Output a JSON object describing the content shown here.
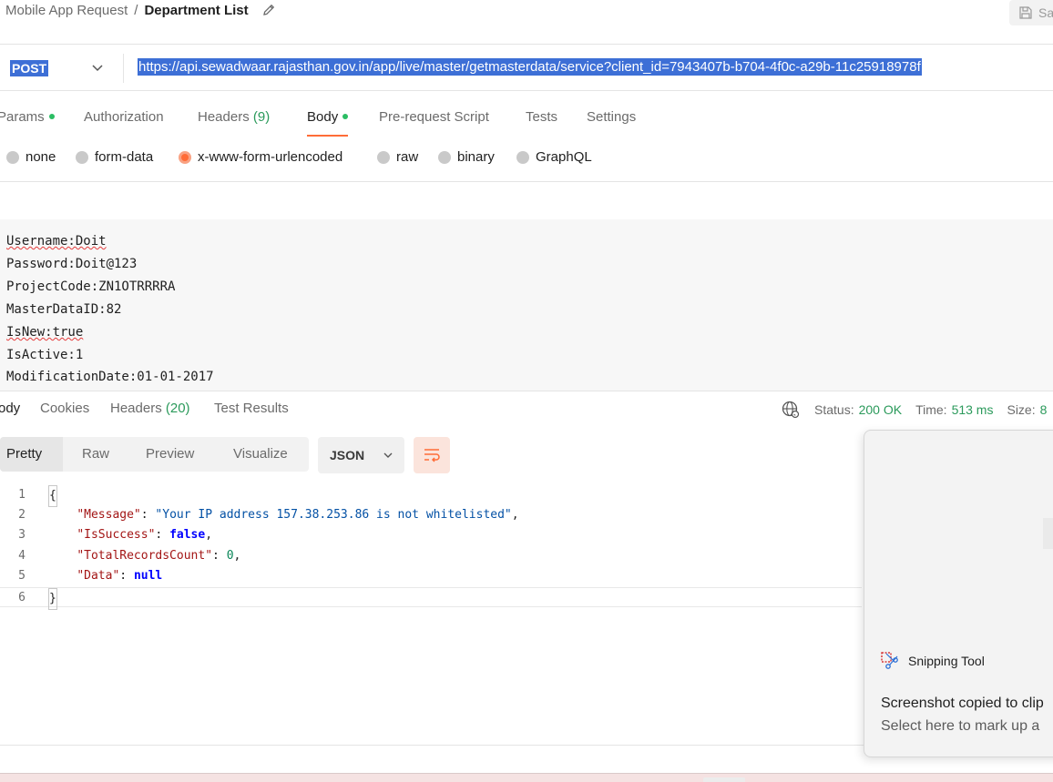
{
  "breadcrumb": {
    "parent": "Mobile App Request",
    "separator": "/",
    "current": "Department List"
  },
  "save_label": "Sa",
  "request": {
    "method": "POST",
    "url": "https://api.sewadwaar.rajasthan.gov.in/app/live/master/getmasterdata/service?client_id=7943407b-b704-4f0c-a29b-11c25918978f"
  },
  "request_tabs": [
    {
      "label": "Params",
      "dot": true
    },
    {
      "label": "Authorization"
    },
    {
      "label": "Headers",
      "count": "(9)"
    },
    {
      "label": "Body",
      "dot": true,
      "active": true
    },
    {
      "label": "Pre-request Script"
    },
    {
      "label": "Tests"
    },
    {
      "label": "Settings"
    }
  ],
  "body_types": [
    {
      "label": "none",
      "selected": false
    },
    {
      "label": "form-data",
      "selected": false
    },
    {
      "label": "x-www-form-urlencoded",
      "selected": true
    },
    {
      "label": "raw",
      "selected": false
    },
    {
      "label": "binary",
      "selected": false
    },
    {
      "label": "GraphQL",
      "selected": false
    }
  ],
  "body_lines": [
    "Username:Doit",
    "Password:Doit@123",
    "ProjectCode:ZN1OTRRRRA",
    "MasterDataID:82",
    "IsNew:true",
    "IsActive:1",
    "ModificationDate:01-01-2017"
  ],
  "response_tabs": [
    {
      "label": "ody",
      "active": true
    },
    {
      "label": "Cookies"
    },
    {
      "label": "Headers",
      "count": "(20)"
    },
    {
      "label": "Test Results"
    }
  ],
  "response_meta": {
    "status_label": "Status:",
    "status_value": "200 OK",
    "time_label": "Time:",
    "time_value": "513 ms",
    "size_label": "Size:",
    "size_value": "8"
  },
  "view_modes": [
    "Pretty",
    "Raw",
    "Preview",
    "Visualize"
  ],
  "format": "JSON",
  "code": {
    "line_numbers": [
      "1",
      "2",
      "3",
      "4",
      "5",
      "6"
    ],
    "open_brace": "{",
    "close_brace": "}",
    "message_key": "\"Message\"",
    "message_value": "\"Your IP address 157.38.253.86 is not whitelisted\"",
    "issuccess_key": "\"IsSuccess\"",
    "issuccess_value": "false",
    "total_key": "\"TotalRecordsCount\"",
    "total_value": "0",
    "data_key": "\"Data\"",
    "data_value": "null"
  },
  "toast": {
    "app_name": "Snipping Tool",
    "title": "Screenshot copied to clip",
    "subtitle": "Select here to mark up a"
  },
  "colors": {
    "accent": "#ff6c37",
    "selection": "#3d6fd6",
    "success": "#2b9a5b"
  }
}
